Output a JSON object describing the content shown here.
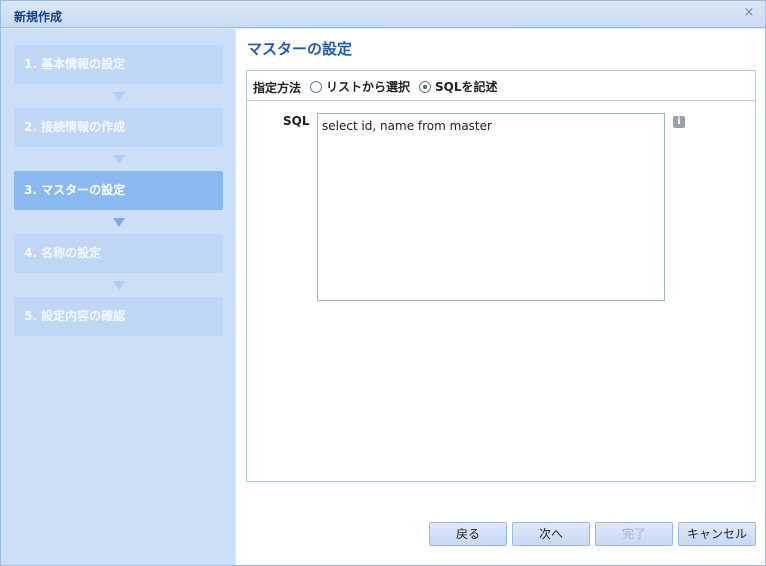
{
  "window": {
    "title": "新規作成",
    "close_glyph": "×"
  },
  "sidebar": {
    "steps": [
      {
        "label": "1. 基本情報の設定",
        "state": "inactive"
      },
      {
        "label": "2. 接続情報の作成",
        "state": "inactive"
      },
      {
        "label": "3. マスターの設定",
        "state": "active"
      },
      {
        "label": "4. 名称の設定",
        "state": "inactive"
      },
      {
        "label": "5. 設定内容の確認",
        "state": "inactive"
      }
    ]
  },
  "main": {
    "title": "マスターの設定",
    "method": {
      "label": "指定方法",
      "options": [
        {
          "label": "リストから選択",
          "checked": false
        },
        {
          "label": "SQLを記述",
          "checked": true
        }
      ]
    },
    "sql": {
      "label": "SQL",
      "value": "select id, name from master"
    },
    "info_icon": "info-icon"
  },
  "footer": {
    "back_label": "戻る",
    "next_label": "次へ",
    "finish_label": "完了",
    "cancel_label": "キャンセル"
  },
  "colors": {
    "accent": "#1c5bbd",
    "active_step": "#8ab8f1",
    "inactive_step": "#bfd6f5"
  }
}
